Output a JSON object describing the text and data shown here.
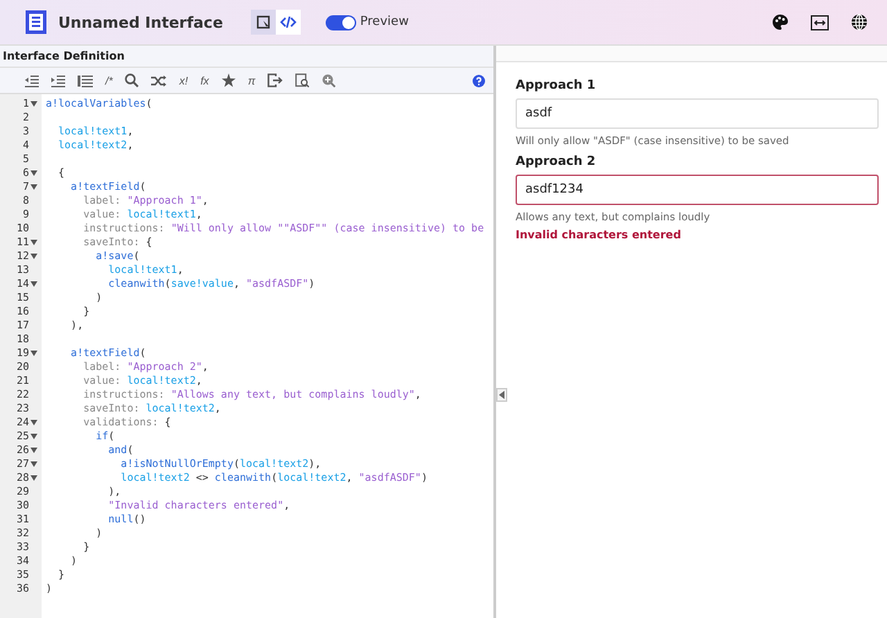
{
  "header": {
    "title": "Unnamed Interface",
    "modes": [
      {
        "kind": "design",
        "selected": false
      },
      {
        "kind": "code",
        "selected": true
      }
    ],
    "preview": {
      "label": "Preview",
      "on": true
    },
    "tools": [
      {
        "kind": "palette"
      },
      {
        "kind": "width"
      },
      {
        "kind": "globe"
      }
    ]
  },
  "editor": {
    "title": "Interface Definition",
    "toolbar": [
      {
        "kind": "outdent"
      },
      {
        "kind": "indent"
      },
      {
        "kind": "list"
      },
      {
        "kind": "text",
        "label": "/*"
      },
      {
        "kind": "search"
      },
      {
        "kind": "shuffle"
      },
      {
        "kind": "text",
        "label": "x!"
      },
      {
        "kind": "text",
        "label": "fx"
      },
      {
        "kind": "star"
      },
      {
        "kind": "text",
        "label": "π"
      },
      {
        "kind": "exit"
      },
      {
        "kind": "doc"
      },
      {
        "kind": "zoom"
      }
    ],
    "lines": [
      {
        "number": "1",
        "fold": true,
        "tokens": [
          {
            "kind": "fn",
            "text": "a!localVariables"
          },
          {
            "kind": "p",
            "text": "("
          }
        ]
      },
      {
        "number": "2",
        "fold": false
      },
      {
        "number": "3",
        "fold": false,
        "tokens": [
          {
            "kind": "var",
            "text": "  local!text1"
          },
          {
            "kind": "p",
            "text": ","
          }
        ]
      },
      {
        "number": "4",
        "fold": false,
        "tokens": [
          {
            "kind": "var",
            "text": "  local!text2"
          },
          {
            "kind": "p",
            "text": ","
          }
        ]
      },
      {
        "number": "5",
        "fold": false
      },
      {
        "number": "6",
        "fold": true,
        "tokens": [
          {
            "kind": "p",
            "text": "  {"
          }
        ]
      },
      {
        "number": "7",
        "fold": true,
        "tokens": [
          {
            "kind": "fn",
            "text": "    a!textField"
          },
          {
            "kind": "p",
            "text": "("
          }
        ]
      },
      {
        "number": "8",
        "fold": false,
        "tokens": [
          {
            "kind": "key",
            "text": "      label: "
          },
          {
            "kind": "str",
            "text": "\"Approach 1\""
          },
          {
            "kind": "p",
            "text": ","
          }
        ]
      },
      {
        "number": "9",
        "fold": false,
        "tokens": [
          {
            "kind": "key",
            "text": "      value: "
          },
          {
            "kind": "var",
            "text": "local!text1"
          },
          {
            "kind": "p",
            "text": ","
          }
        ]
      },
      {
        "number": "10",
        "fold": false,
        "tokens": [
          {
            "kind": "key",
            "text": "      instructions: "
          },
          {
            "kind": "str",
            "text": "\"Will only allow \"\"ASDF\"\" (case insensitive) to be"
          }
        ]
      },
      {
        "number": "11",
        "fold": true,
        "tokens": [
          {
            "kind": "key",
            "text": "      saveInto: "
          },
          {
            "kind": "p",
            "text": "{"
          }
        ]
      },
      {
        "number": "12",
        "fold": true,
        "tokens": [
          {
            "kind": "fn",
            "text": "        a!save"
          },
          {
            "kind": "p",
            "text": "("
          }
        ]
      },
      {
        "number": "13",
        "fold": false,
        "tokens": [
          {
            "kind": "var",
            "text": "          local!text1"
          },
          {
            "kind": "p",
            "text": ","
          }
        ]
      },
      {
        "number": "14",
        "fold": true,
        "tokens": [
          {
            "kind": "fn",
            "text": "          cleanwith"
          },
          {
            "kind": "p",
            "text": "("
          },
          {
            "kind": "var",
            "text": "save!value"
          },
          {
            "kind": "p",
            "text": ", "
          },
          {
            "kind": "str",
            "text": "\"asdfASDF\""
          },
          {
            "kind": "p",
            "text": ")"
          }
        ]
      },
      {
        "number": "15",
        "fold": false,
        "tokens": [
          {
            "kind": "p",
            "text": "        )"
          }
        ]
      },
      {
        "number": "16",
        "fold": false,
        "tokens": [
          {
            "kind": "p",
            "text": "      }"
          }
        ]
      },
      {
        "number": "17",
        "fold": false,
        "tokens": [
          {
            "kind": "p",
            "text": "    ),"
          }
        ]
      },
      {
        "number": "18",
        "fold": false
      },
      {
        "number": "19",
        "fold": true,
        "tokens": [
          {
            "kind": "fn",
            "text": "    a!textField"
          },
          {
            "kind": "p",
            "text": "("
          }
        ]
      },
      {
        "number": "20",
        "fold": false,
        "tokens": [
          {
            "kind": "key",
            "text": "      label: "
          },
          {
            "kind": "str",
            "text": "\"Approach 2\""
          },
          {
            "kind": "p",
            "text": ","
          }
        ]
      },
      {
        "number": "21",
        "fold": false,
        "tokens": [
          {
            "kind": "key",
            "text": "      value: "
          },
          {
            "kind": "var",
            "text": "local!text2"
          },
          {
            "kind": "p",
            "text": ","
          }
        ]
      },
      {
        "number": "22",
        "fold": false,
        "tokens": [
          {
            "kind": "key",
            "text": "      instructions: "
          },
          {
            "kind": "str",
            "text": "\"Allows any text, but complains loudly\""
          },
          {
            "kind": "p",
            "text": ","
          }
        ]
      },
      {
        "number": "23",
        "fold": false,
        "tokens": [
          {
            "kind": "key",
            "text": "      saveInto: "
          },
          {
            "kind": "var",
            "text": "local!text2"
          },
          {
            "kind": "p",
            "text": ","
          }
        ]
      },
      {
        "number": "24",
        "fold": true,
        "tokens": [
          {
            "kind": "key",
            "text": "      validations: "
          },
          {
            "kind": "p",
            "text": "{"
          }
        ]
      },
      {
        "number": "25",
        "fold": true,
        "tokens": [
          {
            "kind": "fn",
            "text": "        if"
          },
          {
            "kind": "p",
            "text": "("
          }
        ]
      },
      {
        "number": "26",
        "fold": true,
        "tokens": [
          {
            "kind": "fn",
            "text": "          and"
          },
          {
            "kind": "p",
            "text": "("
          }
        ]
      },
      {
        "number": "27",
        "fold": true,
        "tokens": [
          {
            "kind": "fn",
            "text": "            a!isNotNullOrEmpty"
          },
          {
            "kind": "p",
            "text": "("
          },
          {
            "kind": "var",
            "text": "local!text2"
          },
          {
            "kind": "p",
            "text": "),"
          }
        ]
      },
      {
        "number": "28",
        "fold": true,
        "tokens": [
          {
            "kind": "var",
            "text": "            local!text2"
          },
          {
            "kind": "p",
            "text": " <> "
          },
          {
            "kind": "fn",
            "text": "cleanwith"
          },
          {
            "kind": "p",
            "text": "("
          },
          {
            "kind": "var",
            "text": "local!text2"
          },
          {
            "kind": "p",
            "text": ", "
          },
          {
            "kind": "str",
            "text": "\"asdfASDF\""
          },
          {
            "kind": "p",
            "text": ")"
          }
        ]
      },
      {
        "number": "29",
        "fold": false,
        "tokens": [
          {
            "kind": "p",
            "text": "          ),"
          }
        ]
      },
      {
        "number": "30",
        "fold": false,
        "tokens": [
          {
            "kind": "str",
            "text": "          \"Invalid characters entered\""
          },
          {
            "kind": "p",
            "text": ","
          }
        ]
      },
      {
        "number": "31",
        "fold": false,
        "tokens": [
          {
            "kind": "fn",
            "text": "          null"
          },
          {
            "kind": "p",
            "text": "()"
          }
        ]
      },
      {
        "number": "32",
        "fold": false,
        "tokens": [
          {
            "kind": "p",
            "text": "        )"
          }
        ]
      },
      {
        "number": "33",
        "fold": false,
        "tokens": [
          {
            "kind": "p",
            "text": "      }"
          }
        ]
      },
      {
        "number": "34",
        "fold": false,
        "tokens": [
          {
            "kind": "p",
            "text": "    )"
          }
        ]
      },
      {
        "number": "35",
        "fold": false,
        "tokens": [
          {
            "kind": "p",
            "text": "  }"
          }
        ]
      },
      {
        "number": "36",
        "fold": false,
        "tokens": [
          {
            "kind": "p",
            "text": ")"
          }
        ]
      }
    ]
  },
  "preview_form": {
    "fields": [
      {
        "label": "Approach 1",
        "value": "asdf",
        "instructions": "Will only allow \"ASDF\" (case insensitive) to be saved",
        "invalid": false
      },
      {
        "label": "Approach 2",
        "value": "asdf1234",
        "instructions": "Allows any text, but complains loudly",
        "invalid": true,
        "error": "Invalid characters entered"
      }
    ]
  }
}
